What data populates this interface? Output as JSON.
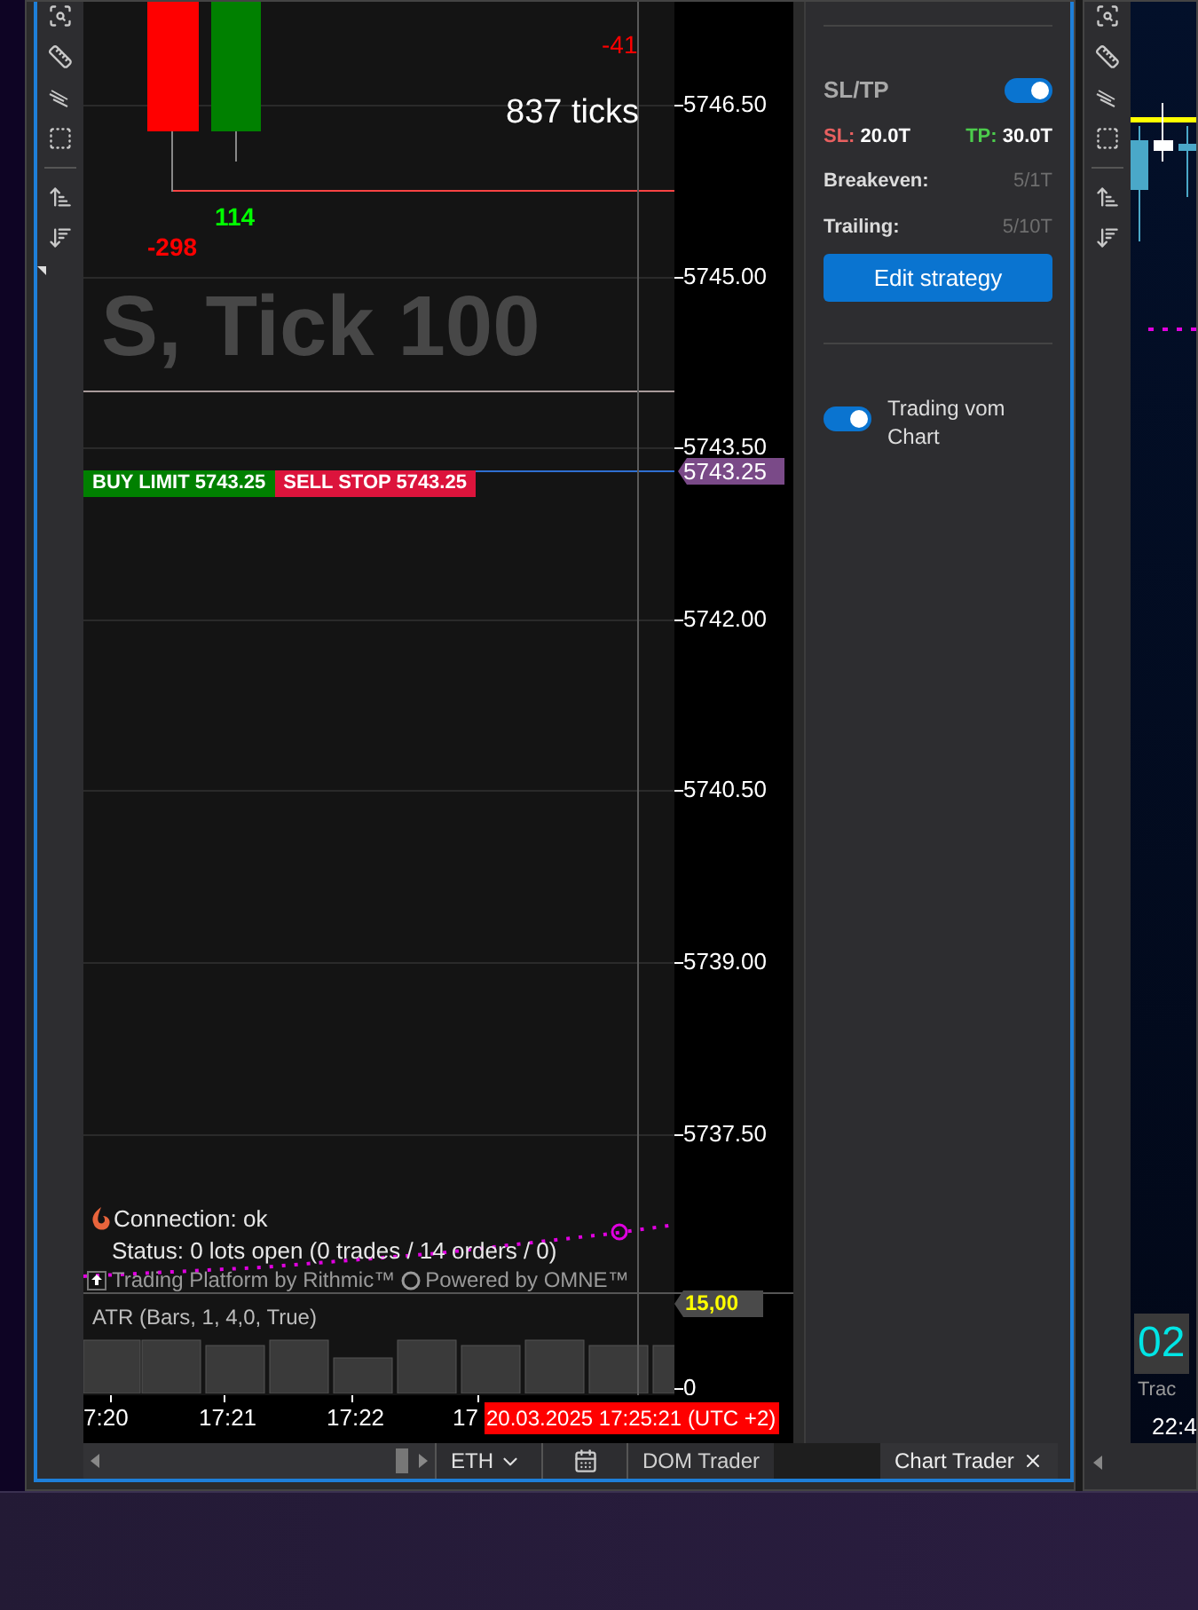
{
  "chart": {
    "watermark": "S, Tick 100",
    "candle_labels": [
      {
        "text": "-41",
        "kind": "loss"
      },
      {
        "text": "-298",
        "kind": "loss"
      },
      {
        "text": "114",
        "kind": "gain"
      }
    ],
    "range_text": "837 ticks",
    "orders": [
      {
        "text": "BUY LIMIT 5743.25",
        "kind": "buy"
      },
      {
        "text": "SELL STOP 5743.25",
        "kind": "sell"
      }
    ],
    "connection": "Connection: ok",
    "status": "Status: 0 lots open (0 trades / 14 orders / 0)",
    "platform": "Trading Platform by Rithmic™",
    "powered": "Powered by OMNE™",
    "indicator": "ATR (Bars, 1, 4,0, True)"
  },
  "price_axis": {
    "labels": [
      "5746.50",
      "5745.00",
      "5743.50",
      "5742.00",
      "5740.50",
      "5739.00",
      "5737.50"
    ],
    "last_price": "5743.25",
    "indicator_value": "15,00",
    "indicator_zero": "0"
  },
  "time_axis": {
    "labels": [
      "7:20",
      "17:21",
      "17:22",
      "17"
    ],
    "crosshair": "20.03.2025 17:25:21 (UTC +2)"
  },
  "strategy_panel": {
    "title": "SL/TP",
    "on": true,
    "sl_label": "SL:",
    "sl_value": "20.0T",
    "tp_label": "TP:",
    "tp_value": "30.0T",
    "rows": [
      {
        "label": "Breakeven:",
        "value": "5/1T"
      },
      {
        "label": "Trailing:",
        "value": "5/10T"
      }
    ],
    "button": "Edit strategy",
    "chart_trading": {
      "label": "Trading vom Chart",
      "on": true
    }
  },
  "bottom_bar": {
    "instrument": "ETH",
    "tabs": [
      {
        "label": "DOM Trader",
        "selected": false,
        "closable": false
      },
      {
        "label": "Chart Trader",
        "selected": true,
        "closable": true
      }
    ]
  },
  "side_window": {
    "value": "02",
    "label": "Trac",
    "time": "22:4"
  }
}
